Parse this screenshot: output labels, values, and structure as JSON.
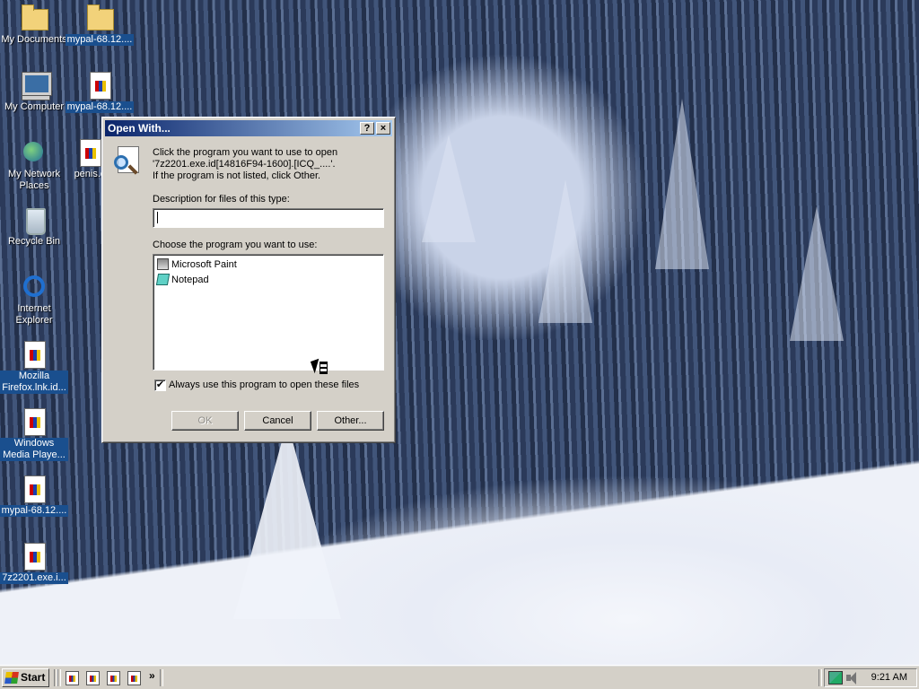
{
  "desktop": {
    "icons": [
      {
        "label": "My Documents"
      },
      {
        "label": "mypal-68.12...."
      },
      {
        "label": "My Computer"
      },
      {
        "label": "mypal-68.12...."
      },
      {
        "label": "My Network Places"
      },
      {
        "label": "penis.c"
      },
      {
        "label": "Recycle Bin"
      },
      {
        "label": "Internet Explorer"
      },
      {
        "label": "Mozilla Firefox.lnk.id..."
      },
      {
        "label": "Windows Media Playe..."
      },
      {
        "label": "mypal-68.12...."
      },
      {
        "label": "7z2201.exe.i..."
      }
    ]
  },
  "dialog": {
    "title": "Open With...",
    "help_button": "?",
    "close_button": "×",
    "instructions": [
      "Click the program you want to use to open",
      "'7z2201.exe.id[14816F94-1600].[ICQ_....'.",
      "If the program is not listed, click Other."
    ],
    "description_label": "Description for files of this type:",
    "description_value": "",
    "programs_label": "Choose the program you want to use:",
    "programs": [
      {
        "name": "Microsoft Paint",
        "icon": "paint-icon"
      },
      {
        "name": "Notepad",
        "icon": "notepad-icon"
      }
    ],
    "always_use_checkmark": "✔",
    "always_use_label": "Always use this program to open these files",
    "always_use_checked": true,
    "buttons": {
      "ok": "OK",
      "cancel": "Cancel",
      "other": "Other..."
    }
  },
  "taskbar": {
    "start_label": "Start",
    "quick_launch_more": "»",
    "clock": "9:21 AM"
  }
}
